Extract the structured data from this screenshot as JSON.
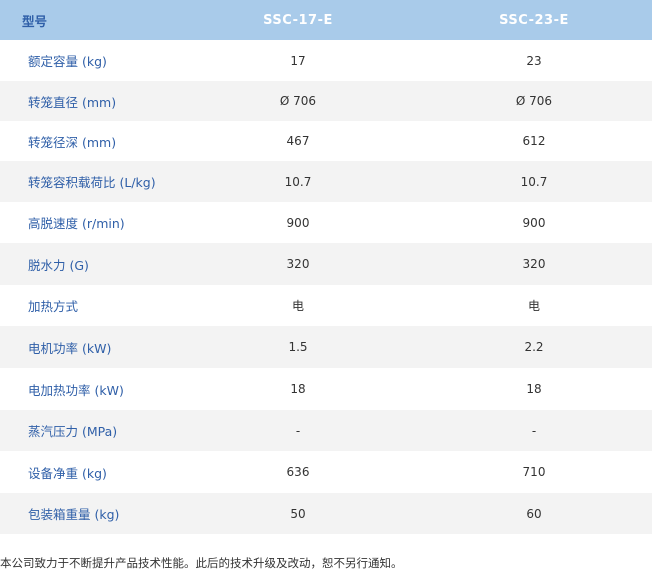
{
  "table": {
    "header": {
      "label": "型号",
      "model1": "SSC-17-E",
      "model2": "SSC-23-E"
    },
    "rows": [
      {
        "label": "额定容量 (kg)",
        "model1": "17",
        "model2": "23"
      },
      {
        "label": "转笼直径 (mm)",
        "model1": "Ø 706",
        "model2": "Ø 706"
      },
      {
        "label": "转笼径深 (mm)",
        "model1": "467",
        "model2": "612"
      },
      {
        "label": "转笼容积载荷比 (L/kg)",
        "model1": "10.7",
        "model2": "10.7"
      },
      {
        "label": "高脱速度 (r/min)",
        "model1": "900",
        "model2": "900"
      },
      {
        "label": "脱水力 (G)",
        "model1": "320",
        "model2": "320"
      },
      {
        "label": "加热方式",
        "model1": "电",
        "model2": "电"
      },
      {
        "label": "电机功率 (kW)",
        "model1": "1.5",
        "model2": "2.2"
      },
      {
        "label": "电加热功率 (kW)",
        "model1": "18",
        "model2": "18"
      },
      {
        "label": "蒸汽压力 (MPa)",
        "model1": "-",
        "model2": "-"
      },
      {
        "label": "设备净重 (kg)",
        "model1": "636",
        "model2": "710"
      },
      {
        "label": "包装箱重量 (kg)",
        "model1": "50",
        "model2": "60"
      }
    ]
  },
  "footnote": "本公司致力于不断提升产品技术性能。此后的技术升级及改动，恕不另行通知。",
  "colors": {
    "header_bg": "#a9cbea",
    "label_text": "#2f5fa8",
    "stripe_bg": "#f3f3f3"
  }
}
